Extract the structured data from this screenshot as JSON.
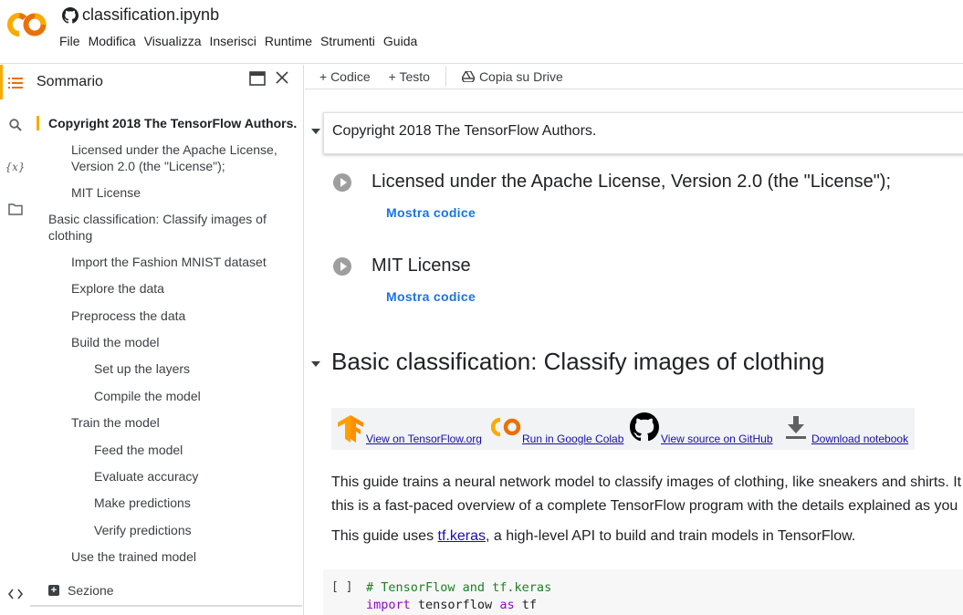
{
  "header": {
    "logo_text": "CO",
    "notebook_title": "classification.ipynb",
    "menu": [
      "File",
      "Modifica",
      "Visualizza",
      "Inserisci",
      "Runtime",
      "Strumenti",
      "Guida"
    ]
  },
  "rail": {
    "icons": [
      "toc-icon",
      "search-icon",
      "variables-icon",
      "folder-icon",
      "code-snippets-icon"
    ],
    "variables_glyph": "{x}"
  },
  "toc": {
    "title": "Sommario",
    "items": [
      {
        "label": "Copyright 2018 The TensorFlow Authors.",
        "level": 0,
        "active": true
      },
      {
        "label": "Licensed under the Apache License, Version 2.0 (the \"License\");",
        "level": 1
      },
      {
        "label": "MIT License",
        "level": 1
      },
      {
        "label": "Basic classification: Classify images of clothing",
        "level": 0
      },
      {
        "label": "Import the Fashion MNIST dataset",
        "level": 1
      },
      {
        "label": "Explore the data",
        "level": 1
      },
      {
        "label": "Preprocess the data",
        "level": 1
      },
      {
        "label": "Build the model",
        "level": 1
      },
      {
        "label": "Set up the layers",
        "level": 2
      },
      {
        "label": "Compile the model",
        "level": 2
      },
      {
        "label": "Train the model",
        "level": 1
      },
      {
        "label": "Feed the model",
        "level": 2
      },
      {
        "label": "Evaluate accuracy",
        "level": 2
      },
      {
        "label": "Make predictions",
        "level": 2
      },
      {
        "label": "Verify predictions",
        "level": 2
      },
      {
        "label": "Use the trained model",
        "level": 1
      }
    ],
    "add_section": "Sezione"
  },
  "toolbar": {
    "add_code": "+ Codice",
    "add_text": "+ Testo",
    "copy_drive": "Copia su Drive"
  },
  "notebook": {
    "copyright_heading": "Copyright 2018 The TensorFlow Authors.",
    "license_heading": "Licensed under the Apache License, Version 2.0 (the \"License\");",
    "mit_heading": "MIT License",
    "show_code": "Mostra codice",
    "section_heading": "Basic classification: Classify images of clothing",
    "badges": [
      {
        "label": "View on TensorFlow.org",
        "icon": "tensorflow-icon"
      },
      {
        "label": "Run in Google Colab",
        "icon": "colab-icon"
      },
      {
        "label": "View source on GitHub",
        "icon": "github-icon"
      },
      {
        "label": "Download notebook",
        "icon": "download-icon"
      }
    ],
    "para1_line1": "This guide trains a neural network model to classify images of clothing, like sneakers and shirts. It",
    "para1_line2": "this is a fast-paced overview of a complete TensorFlow program with the details explained as you",
    "para2_before": "This guide uses ",
    "para2_link": "tf.keras",
    "para2_after": ", a high-level API to build and train models in TensorFlow.",
    "code_prompt": "[ ]",
    "code_comment": "# TensorFlow and tf.keras",
    "code_import_kw": "import",
    "code_module": " tensorflow ",
    "code_as_kw": "as",
    "code_alias": " tf"
  }
}
